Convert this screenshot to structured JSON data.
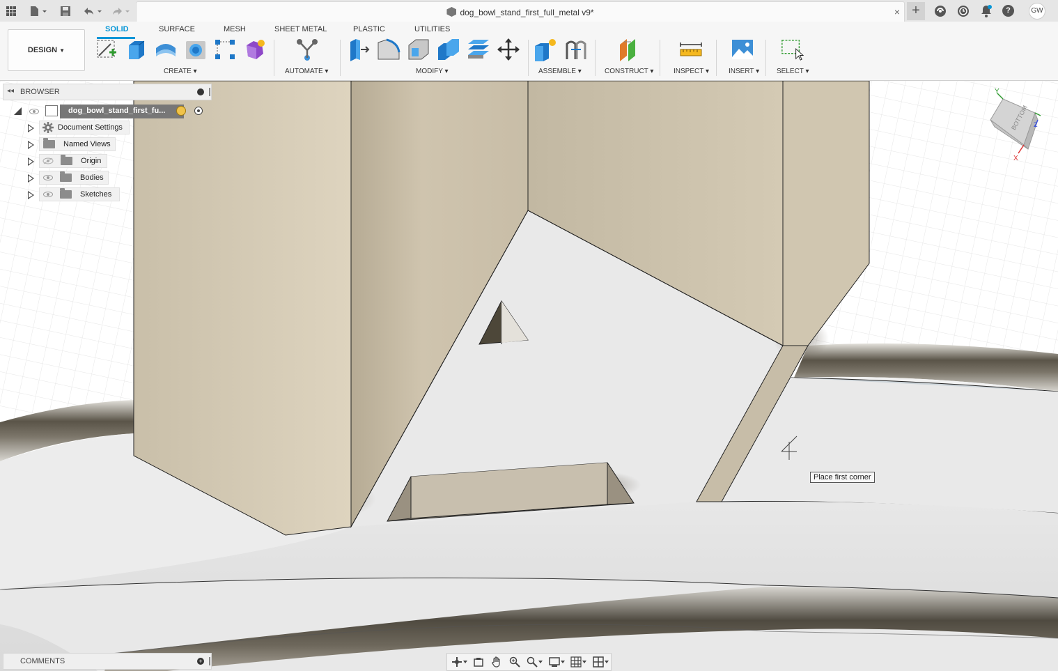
{
  "titlebar": {
    "document_title": "dog_bowl_stand_first_full_metal v9*",
    "close_glyph": "×",
    "new_tab_glyph": "+",
    "user_initials": "GW",
    "icons": [
      "apps-grid-icon",
      "file-menu-icon",
      "save-icon",
      "undo-icon",
      "redo-icon",
      "extensions-icon",
      "job-status-icon",
      "notifications-icon",
      "help-icon"
    ]
  },
  "toolbar": {
    "workspace": "DESIGN",
    "tabs": [
      "SOLID",
      "SURFACE",
      "MESH",
      "SHEET METAL",
      "PLASTIC",
      "UTILITIES"
    ],
    "active_tab": "SOLID",
    "groups": {
      "create": "CREATE",
      "automate": "AUTOMATE",
      "modify": "MODIFY",
      "assemble": "ASSEMBLE",
      "construct": "CONSTRUCT",
      "inspect": "INSPECT",
      "insert": "INSERT",
      "select": "SELECT"
    },
    "accent_color": "#0696d7"
  },
  "browser": {
    "title": "BROWSER",
    "root": "dog_bowl_stand_first_fu...",
    "items": [
      {
        "label": "Document Settings",
        "icon": "gear-icon"
      },
      {
        "label": "Named Views",
        "icon": "folder-icon"
      },
      {
        "label": "Origin",
        "icon": "folder-icon",
        "visibility": "hidden"
      },
      {
        "label": "Bodies",
        "icon": "folder-icon",
        "visibility": "visible"
      },
      {
        "label": "Sketches",
        "icon": "folder-icon",
        "visibility": "visible"
      }
    ]
  },
  "viewport": {
    "tooltip": "Place first corner",
    "viewcube_face": "BOTTOM",
    "axis_labels": {
      "x": "X",
      "y": "Y",
      "z": "Z"
    }
  },
  "comments": {
    "title": "COMMENTS"
  },
  "navbar": {
    "icons": [
      "orbit-icon",
      "look-at-icon",
      "pan-icon",
      "zoom-icon",
      "fit-icon",
      "display-settings-icon",
      "grid-settings-icon",
      "viewports-icon"
    ]
  }
}
